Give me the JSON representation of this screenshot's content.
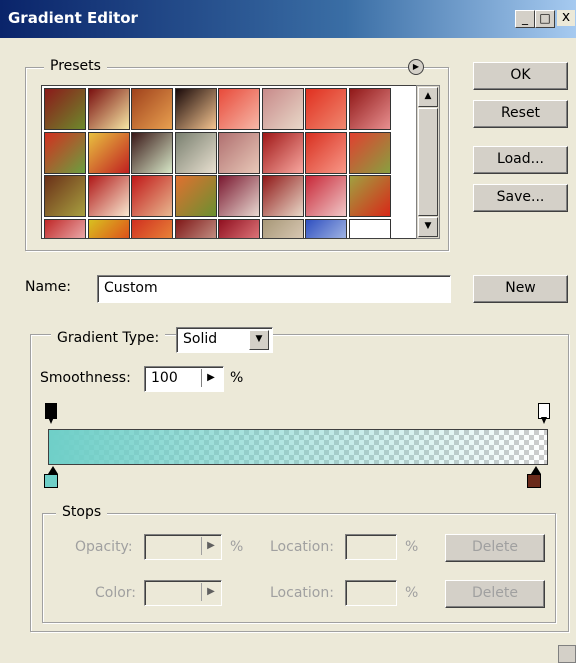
{
  "window": {
    "title": "Gradient Editor",
    "controls": [
      "_",
      "□",
      "x"
    ]
  },
  "presets": {
    "legend": "Presets",
    "swatches": [
      [
        "#8b1a1a",
        "#6d8a2c"
      ],
      [
        "#7a1010",
        "#f6e7a5"
      ],
      [
        "#a0421c",
        "#e8a050"
      ],
      [
        "#1a0a0a",
        "#f4c490"
      ],
      [
        "#e84a3a",
        "#f6b8a8"
      ],
      [
        "#c88a8a",
        "#e8d8c8"
      ],
      [
        "#e03020",
        "#f08870"
      ],
      [
        "#901818",
        "#e89090"
      ],
      [
        "#d23020",
        "#6aa040"
      ],
      [
        "#e8c040",
        "#c02020"
      ],
      [
        "#3a1818",
        "#d8e8c8"
      ],
      [
        "#7a8070",
        "#e8e0d0"
      ],
      [
        "#b07070",
        "#e8c8b8"
      ],
      [
        "#a01818",
        "#f8a8a0"
      ],
      [
        "#d83020",
        "#f89888"
      ],
      [
        "#e04030",
        "#88a040"
      ],
      [
        "#6a3018",
        "#a8a040"
      ],
      [
        "#b01818",
        "#f8e8d0"
      ],
      [
        "#c01818",
        "#e8b890"
      ],
      [
        "#e07030",
        "#6a9030"
      ],
      [
        "#7a1830",
        "#e8d8d0"
      ],
      [
        "#901818",
        "#e8d8c8"
      ],
      [
        "#c82838",
        "#f0c8c8"
      ],
      [
        "#a0a040",
        "#d82818"
      ],
      [
        "#c02828",
        "#f8d8d8"
      ],
      [
        "#d8c020",
        "#e02818"
      ],
      [
        "#d03020",
        "#f0a040"
      ],
      [
        "#801818",
        "#d8b8a8"
      ],
      [
        "#901020",
        "#f89898"
      ],
      [
        "#a89878",
        "#e8d8c8"
      ],
      [
        "#3050c0",
        "#c8d8f0"
      ],
      [
        "#ffffff",
        "#ffffff"
      ]
    ]
  },
  "buttons": {
    "ok": "OK",
    "reset": "Reset",
    "load": "Load...",
    "save": "Save...",
    "new": "New"
  },
  "name": {
    "label": "Name:",
    "value": "Custom"
  },
  "gradient": {
    "type_label": "Gradient Type:",
    "type_value": "Solid",
    "smoothness_label": "Smoothness:",
    "smoothness_value": "100",
    "smoothness_unit": "%",
    "start_color": "#6fcfc8"
  },
  "stops": {
    "legend": "Stops",
    "opacity_label": "Opacity:",
    "opacity_unit": "%",
    "color_label": "Color:",
    "location_label": "Location:",
    "location_unit": "%",
    "delete": "Delete"
  }
}
